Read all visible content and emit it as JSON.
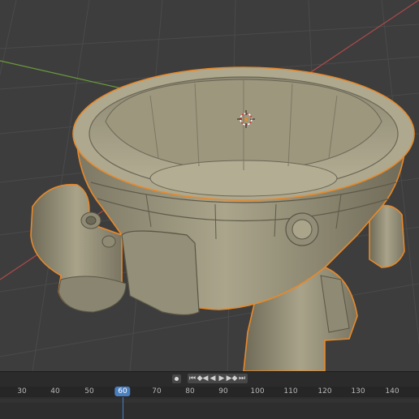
{
  "timeline": {
    "frame_labels": [
      "30",
      "40",
      "50",
      "60",
      "70",
      "80",
      "90",
      "100",
      "110",
      "120",
      "130",
      "140"
    ],
    "current_frame": "60",
    "transport": {
      "record": "record-keyframe",
      "jump_start": "⏮",
      "prev_key": "◆◀",
      "play_reverse": "◀",
      "play": "▶",
      "next_key": "▶◆",
      "jump_end": "⏭"
    }
  },
  "colors": {
    "viewport_bg": "#3d3d3d",
    "grid": "#4a4a4a",
    "x_axis": "#b04a4a",
    "y_axis": "#6a9a3a",
    "selection_outline": "#e8892a",
    "model_fill": "#a59f86",
    "playhead": "#4a7fc0"
  }
}
